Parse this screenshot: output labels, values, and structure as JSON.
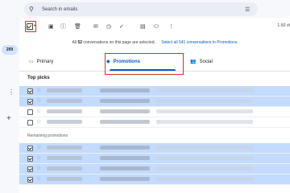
{
  "search": {
    "placeholder": "Search in emails"
  },
  "rail": {
    "badge": "209"
  },
  "toolbar": {
    "select_icon": "select-all-checkbox",
    "buttons": [
      "archive-icon",
      "report-spam-icon",
      "delete-icon",
      "mark-unread-icon",
      "snooze-icon",
      "add-task-icon",
      "move-to-icon",
      "label-icon",
      "more-icon"
    ],
    "pager": "1-50 of"
  },
  "banner": {
    "prefix": "All",
    "count": "52",
    "suffix": "conversations on this page are selected.",
    "link": "Select all 541 conversations in Promotions"
  },
  "tabs": [
    {
      "label": "Primary",
      "icon": "inbox-icon"
    },
    {
      "label": "Promotions",
      "icon": "tag-icon"
    },
    {
      "label": "Social",
      "icon": "people-icon"
    }
  ],
  "sections": {
    "top_picks": "Top picks",
    "remaining": "Remaining promotions"
  },
  "rows_top": [
    {
      "selected": true
    },
    {
      "selected": true
    },
    {
      "selected": false
    },
    {
      "selected": false
    }
  ],
  "rows_remaining": [
    {
      "selected": true
    },
    {
      "selected": true
    },
    {
      "selected": true
    },
    {
      "selected": true
    }
  ],
  "colors": {
    "accent": "#0b57d0",
    "highlight_outline": "#d93025",
    "selected_row": "#c2dbff"
  }
}
